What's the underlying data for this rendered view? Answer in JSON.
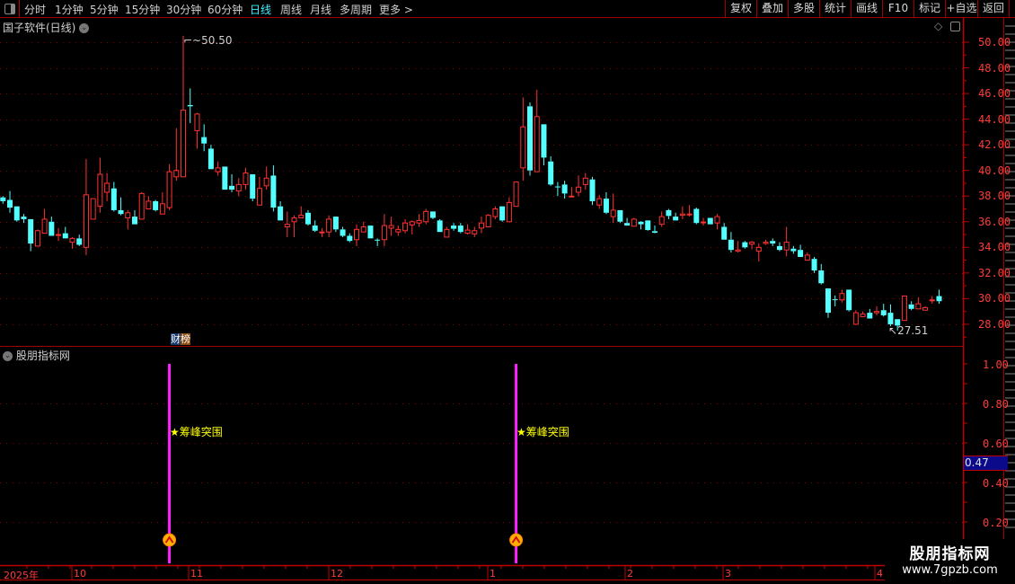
{
  "toolbar": {
    "periods": [
      "分时",
      "1分钟",
      "5分钟",
      "15分钟",
      "30分钟",
      "60分钟",
      "日线",
      "周线",
      "月线",
      "多周期",
      "更多 >"
    ],
    "active_period": "日线",
    "right_buttons": [
      "复权",
      "叠加",
      "多股",
      "统计",
      "画线",
      "F10",
      "标记",
      "+自选",
      "返回"
    ]
  },
  "main_panel": {
    "title": "国子软件(日线)",
    "high_marker": "50.50",
    "low_marker": "27.51",
    "badge_left": "财",
    "badge_right": "榜",
    "price_ticks": [
      "50.00",
      "48.00",
      "46.00",
      "44.00",
      "42.00",
      "40.00",
      "38.00",
      "36.00",
      "34.00",
      "32.00",
      "30.00",
      "28.00"
    ]
  },
  "indicator_panel": {
    "title": "股朋指标网",
    "value_ticks": [
      "1.00",
      "0.80",
      "0.60",
      "0.40",
      "0.20"
    ],
    "current_value": "0.47",
    "signal_label": "★筹峰突围",
    "signal_color": "#ff20ff"
  },
  "date_axis": [
    "2025年",
    "10",
    "11",
    "12",
    "1",
    "2",
    "3",
    "4"
  ],
  "watermark": {
    "line1": "股朋指标网",
    "line2": "www.7gpzb.com"
  },
  "colors": {
    "up": "#ff3232",
    "down": "#54ffff",
    "grid": "#8b0000",
    "axis": "#ff3c3c"
  },
  "chart_data": [
    {
      "type": "candlestick",
      "title": "国子软件(日线)",
      "ylim": [
        27,
        51
      ],
      "fields": [
        "open",
        "high",
        "low",
        "close"
      ],
      "ohlc": [
        [
          37.9,
          38.0,
          37.4,
          37.6
        ],
        [
          37.7,
          38.4,
          36.7,
          37.1
        ],
        [
          37.2,
          37.2,
          36.0,
          36.1
        ],
        [
          36.4,
          36.6,
          35.9,
          36.2
        ],
        [
          36.2,
          36.2,
          33.7,
          34.3
        ],
        [
          34.1,
          35.4,
          34.1,
          35.3
        ],
        [
          35.1,
          37.0,
          35.1,
          36.2
        ],
        [
          36.0,
          36.4,
          34.9,
          34.9
        ],
        [
          34.95,
          35.5,
          34.5,
          35.0
        ],
        [
          35.1,
          35.6,
          34.7,
          34.7
        ],
        [
          34.4,
          34.8,
          33.9,
          34.7
        ],
        [
          34.7,
          35.0,
          34.1,
          34.2
        ],
        [
          34.0,
          40.9,
          33.4,
          38.1
        ],
        [
          36.2,
          37.8,
          36.2,
          37.8
        ],
        [
          37.2,
          41.0,
          36.7,
          39.7
        ],
        [
          38.3,
          39.8,
          37.6,
          39.0
        ],
        [
          38.6,
          39.1,
          36.8,
          36.9
        ],
        [
          36.9,
          37.9,
          36.5,
          36.6
        ],
        [
          36.3,
          36.9,
          35.4,
          36.7
        ],
        [
          36.4,
          36.9,
          35.8,
          35.8
        ],
        [
          36.2,
          38.3,
          36.2,
          38.2
        ],
        [
          37.0,
          38.0,
          37.0,
          37.6
        ],
        [
          37.6,
          37.7,
          36.8,
          36.9
        ],
        [
          36.6,
          38.3,
          36.6,
          37.4
        ],
        [
          37.1,
          40.5,
          36.9,
          39.9
        ],
        [
          39.5,
          43.3,
          39.2,
          40.0
        ],
        [
          39.5,
          50.5,
          39.5,
          44.7
        ],
        [
          45.1,
          46.4,
          43.7,
          45.0
        ],
        [
          43.1,
          44.5,
          41.7,
          44.4
        ],
        [
          42.6,
          43.6,
          41.5,
          42.1
        ],
        [
          41.7,
          42.0,
          40.1,
          40.1
        ],
        [
          39.9,
          40.7,
          39.6,
          40.2
        ],
        [
          40.3,
          40.3,
          38.5,
          38.5
        ],
        [
          38.8,
          39.7,
          38.3,
          38.5
        ],
        [
          38.4,
          39.4,
          38.0,
          38.9
        ],
        [
          38.9,
          40.2,
          38.5,
          39.8
        ],
        [
          39.7,
          39.7,
          37.6,
          37.8
        ],
        [
          37.3,
          39.5,
          37.3,
          38.6
        ],
        [
          38.8,
          40.3,
          38.5,
          39.4
        ],
        [
          39.6,
          40.4,
          36.8,
          37.1
        ],
        [
          37.2,
          37.6,
          36.1,
          36.1
        ],
        [
          35.6,
          36.8,
          34.8,
          35.8
        ],
        [
          36.0,
          36.5,
          34.8,
          36.3
        ],
        [
          36.3,
          37.2,
          36.3,
          36.5
        ],
        [
          36.7,
          36.9,
          35.7,
          35.8
        ],
        [
          35.7,
          36.1,
          35.2,
          35.3
        ],
        [
          35.2,
          35.5,
          34.8,
          35.2
        ],
        [
          35.2,
          36.5,
          34.8,
          36.2
        ],
        [
          36.4,
          36.4,
          35.2,
          35.4
        ],
        [
          35.4,
          35.6,
          34.8,
          34.9
        ],
        [
          34.9,
          35.1,
          34.4,
          34.5
        ],
        [
          34.6,
          35.8,
          34.1,
          35.4
        ],
        [
          35.2,
          36.0,
          35.2,
          35.6
        ],
        [
          35.7,
          35.7,
          34.7,
          34.7
        ],
        [
          34.6,
          34.7,
          34.1,
          34.55
        ],
        [
          34.6,
          36.6,
          34.1,
          35.7
        ],
        [
          35.5,
          36.4,
          34.9,
          35.7
        ],
        [
          35.2,
          35.7,
          34.9,
          35.4
        ],
        [
          35.3,
          36.2,
          35.1,
          35.9
        ],
        [
          35.75,
          36.1,
          35.0,
          36.0
        ],
        [
          35.9,
          36.6,
          35.6,
          36.1
        ],
        [
          36.0,
          37.0,
          35.8,
          36.8
        ],
        [
          36.8,
          36.8,
          36.2,
          36.3
        ],
        [
          36.1,
          36.2,
          35.2,
          35.2
        ],
        [
          34.8,
          35.6,
          34.8,
          35.4
        ],
        [
          35.7,
          35.9,
          35.3,
          35.45
        ],
        [
          35.7,
          35.9,
          35.1,
          35.2
        ],
        [
          35.1,
          35.8,
          35.0,
          35.35
        ],
        [
          35.05,
          35.6,
          34.8,
          35.3
        ],
        [
          35.5,
          36.4,
          35.1,
          35.9
        ],
        [
          35.6,
          36.6,
          35.6,
          36.5
        ],
        [
          36.4,
          37.2,
          36.2,
          37.0
        ],
        [
          37.2,
          37.2,
          36.0,
          36.1
        ],
        [
          36.0,
          37.9,
          36.0,
          37.5
        ],
        [
          37.2,
          39.1,
          37.2,
          39.1
        ],
        [
          40.2,
          45.7,
          39.2,
          43.4
        ],
        [
          45.0,
          45.3,
          39.6,
          40.0
        ],
        [
          39.9,
          46.3,
          39.9,
          44.2
        ],
        [
          43.6,
          43.6,
          40.4,
          41.0
        ],
        [
          40.7,
          41.1,
          38.8,
          38.9
        ],
        [
          38.75,
          39.1,
          38.0,
          38.7
        ],
        [
          38.9,
          39.2,
          37.8,
          38.2
        ],
        [
          37.97,
          38.7,
          37.97,
          38.0
        ],
        [
          38.3,
          39.6,
          38.0,
          38.7
        ],
        [
          38.9,
          39.8,
          38.5,
          39.4
        ],
        [
          39.3,
          39.5,
          37.3,
          37.6
        ],
        [
          37.3,
          38.1,
          37.0,
          37.8
        ],
        [
          37.8,
          38.3,
          36.6,
          36.7
        ],
        [
          36.4,
          38.2,
          35.9,
          36.9
        ],
        [
          36.9,
          36.9,
          35.9,
          36.0
        ],
        [
          35.9,
          36.3,
          35.7,
          35.7
        ],
        [
          35.65,
          36.3,
          35.6,
          36.2
        ],
        [
          36.0,
          36.05,
          35.4,
          35.8
        ],
        [
          36.1,
          36.1,
          35.3,
          35.35
        ],
        [
          35.26,
          35.7,
          35.1,
          35.14
        ],
        [
          35.8,
          36.8,
          35.6,
          36.4
        ],
        [
          36.9,
          37.0,
          36.2,
          36.45
        ],
        [
          36.4,
          36.7,
          36.1,
          36.1
        ],
        [
          36.5,
          37.2,
          36.2,
          36.6
        ],
        [
          36.55,
          37.3,
          36.4,
          36.6
        ],
        [
          37.0,
          37.1,
          35.8,
          35.9
        ],
        [
          35.96,
          36.3,
          35.7,
          35.98
        ],
        [
          36.3,
          36.3,
          35.8,
          35.8
        ],
        [
          35.9,
          36.6,
          35.4,
          36.4
        ],
        [
          35.6,
          35.9,
          34.6,
          34.6
        ],
        [
          34.6,
          35.2,
          33.6,
          33.8
        ],
        [
          33.7,
          34.5,
          33.6,
          33.8
        ],
        [
          34.4,
          34.5,
          33.9,
          34.0
        ],
        [
          34.25,
          34.5,
          33.85,
          34.4
        ],
        [
          33.7,
          34.3,
          32.9,
          34.0
        ],
        [
          34.3,
          34.6,
          34.2,
          34.4
        ],
        [
          34.5,
          34.7,
          34.1,
          34.3
        ],
        [
          34.1,
          34.4,
          33.7,
          33.8
        ],
        [
          33.8,
          35.6,
          33.3,
          34.4
        ],
        [
          33.9,
          34.1,
          33.5,
          33.7
        ],
        [
          33.8,
          34.2,
          33.25,
          33.25
        ],
        [
          33.0,
          33.6,
          33.0,
          33.4
        ],
        [
          33.1,
          33.25,
          32.0,
          32.2
        ],
        [
          32.2,
          32.7,
          31.1,
          31.2
        ],
        [
          30.8,
          30.8,
          28.5,
          28.9
        ],
        [
          29.95,
          30.25,
          29.4,
          29.93
        ],
        [
          29.9,
          30.7,
          29.7,
          30.4
        ],
        [
          30.7,
          30.7,
          29.0,
          29.1
        ],
        [
          28.0,
          29.1,
          28.0,
          28.9
        ],
        [
          28.6,
          29.0,
          28.55,
          28.8
        ],
        [
          28.9,
          29.2,
          28.45,
          28.45
        ],
        [
          28.9,
          29.4,
          28.7,
          29.0
        ],
        [
          29.1,
          29.6,
          28.6,
          28.7
        ],
        [
          28.9,
          29.55,
          27.85,
          28.0
        ],
        [
          28.4,
          28.4,
          27.51,
          27.9
        ],
        [
          28.3,
          30.2,
          28.3,
          30.2
        ],
        [
          29.55,
          29.8,
          29.1,
          29.2
        ],
        [
          29.2,
          30.1,
          29.2,
          29.6
        ],
        [
          29.1,
          29.4,
          29.1,
          29.3
        ],
        [
          29.88,
          30.2,
          29.6,
          29.9
        ],
        [
          30.2,
          30.7,
          29.6,
          29.8
        ]
      ]
    },
    {
      "type": "bar",
      "title": "股朋指标网",
      "ylim": [
        0,
        1.05
      ],
      "signal_indices": [
        24,
        74
      ],
      "signal_value": 1.0,
      "label_value": 0.66,
      "label": "★筹峰突围",
      "current_value": 0.47
    }
  ]
}
